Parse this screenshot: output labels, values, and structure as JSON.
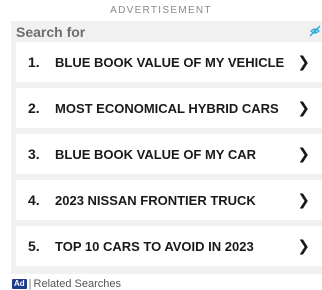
{
  "ad_label": "ADVERTISEMENT",
  "search_for": "Search for",
  "corner_icon": "adchoices-icon",
  "results": [
    {
      "num": "1.",
      "label": "BLUE BOOK VALUE OF MY VEHICLE"
    },
    {
      "num": "2.",
      "label": "MOST ECONOMICAL HYBRID CARS"
    },
    {
      "num": "3.",
      "label": "BLUE BOOK VALUE OF MY CAR"
    },
    {
      "num": "4.",
      "label": "2023 NISSAN FRONTIER TRUCK"
    },
    {
      "num": "5.",
      "label": "TOP 10 CARS TO AVOID IN 2023"
    }
  ],
  "chevron": "❯",
  "footer": {
    "badge": "Ad",
    "separator": "|",
    "related": "Related Searches"
  },
  "colors": {
    "box_bg": "#f1f1f1",
    "badge_bg": "#1f3b8c",
    "icon_accent": "#28a8d8"
  }
}
